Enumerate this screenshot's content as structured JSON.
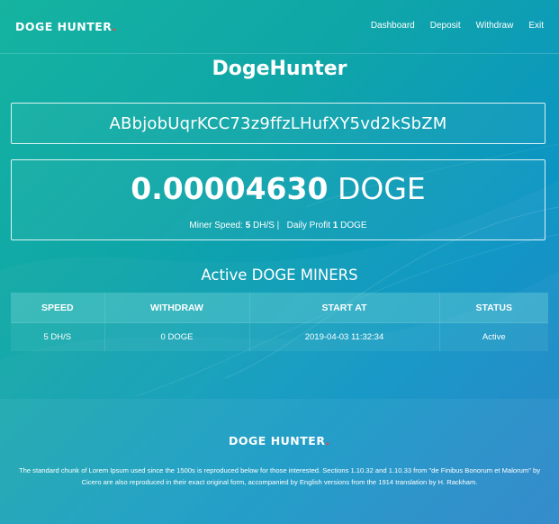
{
  "header": {
    "brand": "DOGE HUNTER",
    "brand_dot": ".",
    "nav": [
      "Dashboard",
      "Deposit",
      "Withdraw",
      "Exit"
    ]
  },
  "main": {
    "title": "DogeHunter",
    "wallet_address": "ABbjobUqrKCC73z9ffzLHufXY5vd2kSbZM",
    "balance": {
      "amount": "0.00004630",
      "unit": "DOGE"
    },
    "stats": {
      "miner_speed_label": "Miner Speed:",
      "miner_speed_value": "5",
      "miner_speed_unit": "DH/S |",
      "daily_profit_label": "Daily Profit",
      "daily_profit_value": "1",
      "daily_profit_unit": "DOGE"
    },
    "miners_section_title": "Active DOGE MINERS",
    "miners_table": {
      "headers": [
        "SPEED",
        "WITHDRAW",
        "START AT",
        "STATUS"
      ],
      "rows": [
        [
          "5 DH/S",
          "0 DOGE",
          "2019-04-03 11:32:34",
          "Active"
        ]
      ]
    }
  },
  "footer": {
    "brand": "DOGE HUNTER",
    "brand_dot": ".",
    "text": "The standard chunk of Lorem Ipsum used since the 1500s is reproduced below for those interested. Sections 1.10.32 and 1.10.33 from \"de Finibus Bonorum et Malorum\" by Cicero are also reproduced in their exact original form, accompanied by English versions from the 1914 translation by H. Rackham."
  },
  "colors": {
    "accent_dot": "#ff3b3b",
    "background_start": "#15b3a0",
    "background_end": "#1f7fc7",
    "text": "#ffffff"
  }
}
